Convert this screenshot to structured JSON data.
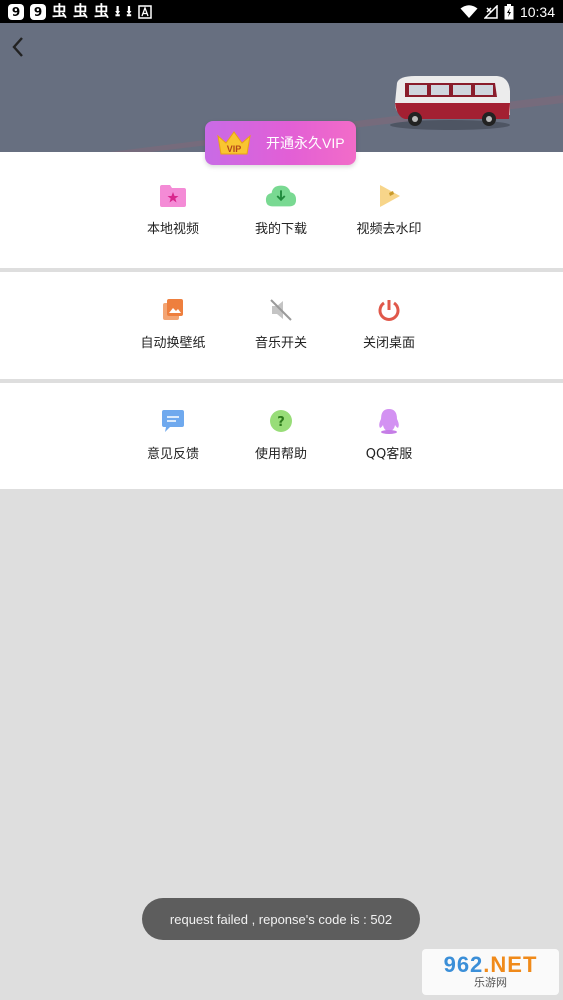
{
  "status_bar": {
    "left_badges": [
      "9",
      "9"
    ],
    "left_glyphs": [
      "虫",
      "虫",
      "虫",
      "⭳",
      "⭳"
    ],
    "time": "10:34"
  },
  "header": {
    "vip_button_label": "开通永久VIP",
    "vip_crown_text": "VIP"
  },
  "menu_sections": [
    {
      "items": [
        {
          "label": "本地视频",
          "icon": "local-video-folder-icon",
          "color": "#f17ad0"
        },
        {
          "label": "我的下载",
          "icon": "download-cloud-icon",
          "color": "#6fd08a"
        },
        {
          "label": "视频去水印",
          "icon": "remove-watermark-icon",
          "color": "#f5cf7a"
        }
      ]
    },
    {
      "items": [
        {
          "label": "自动换壁纸",
          "icon": "wallpaper-icon",
          "color": "#ef8a4a"
        },
        {
          "label": "音乐开关",
          "icon": "music-muted-icon",
          "color": "#b8b8b8"
        },
        {
          "label": "关闭桌面",
          "icon": "power-icon",
          "color": "#e0584a"
        }
      ]
    },
    {
      "items": [
        {
          "label": "意见反馈",
          "icon": "feedback-icon",
          "color": "#6aa6ee"
        },
        {
          "label": "使用帮助",
          "icon": "help-icon",
          "color": "#8fd66e"
        },
        {
          "label": "QQ客服",
          "icon": "qq-penguin-icon",
          "color": "#d38cf0"
        }
      ]
    }
  ],
  "toast": {
    "message": "request failed , reponse's code is : 502"
  },
  "watermark": {
    "line1_digits": "962",
    "line1_suffix": ".NET",
    "line2": "乐游网"
  }
}
